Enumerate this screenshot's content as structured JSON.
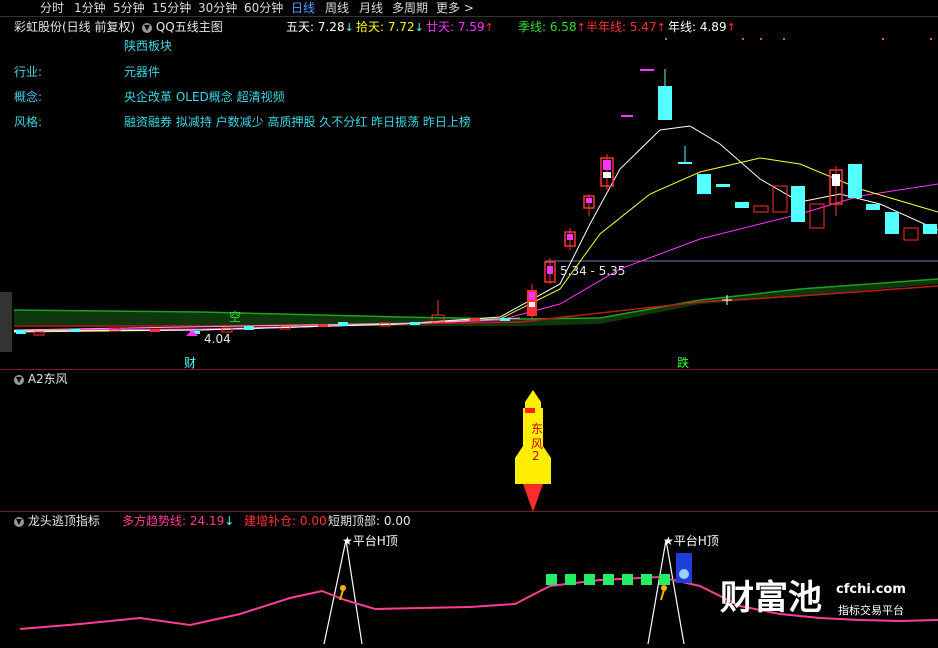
{
  "periods": [
    "分时",
    "1分钟",
    "5分钟",
    "15分钟",
    "30分钟",
    "60分钟",
    "日线",
    "周线",
    "月线",
    "多周期",
    "更多 >"
  ],
  "active_period": "日线",
  "main_panel": {
    "title": "彩虹股份(日线 前复权)",
    "indicator": "QQ五线主图",
    "ma": [
      {
        "label": "五天:",
        "value": "7.28",
        "arrow": "↓",
        "color": "#ffffff"
      },
      {
        "label": "拾天:",
        "value": "7.72",
        "arrow": "↓",
        "color": "#ffff00"
      },
      {
        "label": "廿天:",
        "value": "7.59",
        "arrow": "↑",
        "color": "#ff33ff"
      },
      {
        "label": "季线:",
        "value": "6.58",
        "arrow": "↑",
        "color": "#33dd33"
      },
      {
        "label": "半年线:",
        "value": "5.47",
        "arrow": "↑",
        "color": "#ff3030"
      },
      {
        "label": "年线:",
        "value": "4.89",
        "arrow": "↑",
        "color": "#ffffff"
      }
    ],
    "info": {
      "sector": "陕西板块",
      "industry_label": "行业:",
      "industry": "元器件",
      "concept_label": "概念:",
      "concept": "央企改革 OLED概念 超清视频",
      "style_label": "风格:",
      "style": "融资融券 拟减持 户数减少 高质押股 久不分红 昨日振荡 昨日上榜"
    },
    "price_range_label": "5.34 - 5.35",
    "low_label": "4.04",
    "kong_label": "空",
    "cai_label": "财",
    "die_label": "跌"
  },
  "panel2": {
    "title": "A2东风",
    "rocket_text": [
      "东",
      "风",
      "2"
    ]
  },
  "panel3": {
    "title": "龙头逃顶指标",
    "trend_label": "多方趋势线:",
    "trend_value": "24.19",
    "trend_arrow": "↓",
    "build_label": "建增补仓:",
    "build_value": "0.00",
    "short_label": "短期顶部:",
    "short_value": "0.00",
    "peak1": "平台H顶",
    "peak2": "平台H顶"
  },
  "watermark": {
    "cn": "财富池",
    "domain": "cfchi.com",
    "slogan": "指标交易平台"
  },
  "colors": {
    "up": "#ff3030",
    "down": "#54ffff",
    "pink": "#ff3c96",
    "border": "#7a1a1a"
  }
}
